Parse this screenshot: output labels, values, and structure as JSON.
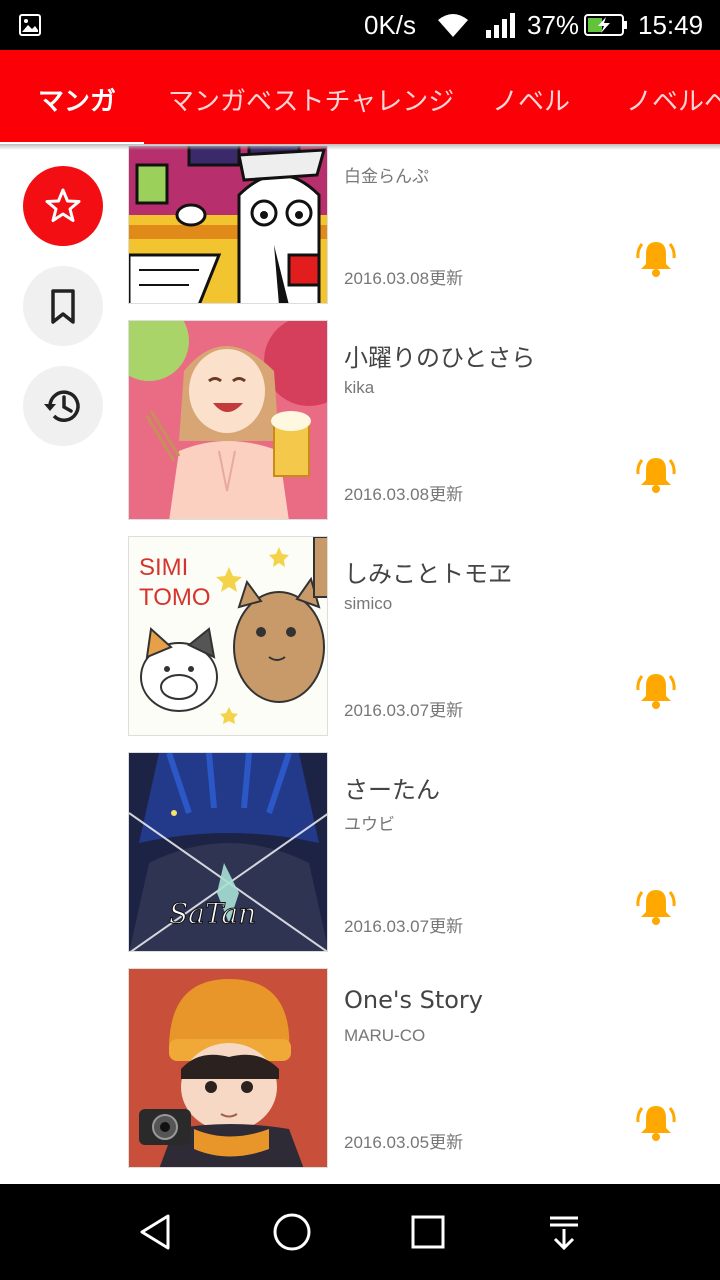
{
  "status_bar": {
    "speed": "0K/s",
    "battery_percent": "37%",
    "time": "15:49",
    "icons": [
      "gallery-icon",
      "wifi-icon",
      "signal-icon",
      "battery-charging-icon"
    ]
  },
  "tabs": [
    {
      "label": "マンガ",
      "selected": true
    },
    {
      "label": "マンガベストチャレンジ",
      "selected": false
    },
    {
      "label": "ノベル",
      "selected": false
    },
    {
      "label": "ノベルベ",
      "selected": false
    }
  ],
  "side_buttons": [
    {
      "name": "favorites",
      "icon": "star-icon",
      "active": true
    },
    {
      "name": "bookmarks",
      "icon": "bookmark-icon",
      "active": false
    },
    {
      "name": "history",
      "icon": "history-icon",
      "active": false
    }
  ],
  "items": [
    {
      "title": "",
      "author": "白金らんぷ",
      "updated": "2016.03.08更新"
    },
    {
      "title": "小躍りのひとさら",
      "author": "kika",
      "updated": "2016.03.08更新"
    },
    {
      "title": "しみことトモヱ",
      "author": "simico",
      "updated": "2016.03.07更新"
    },
    {
      "title": "さーたん",
      "author": "ユウビ",
      "updated": "2016.03.07更新"
    },
    {
      "title": "One's Story",
      "author": "MARU-CO",
      "updated": "2016.03.05更新"
    }
  ],
  "thumb_texts": {
    "simitomo_line1": "SIMI",
    "simitomo_line2": "TOMO",
    "saatan_logo": "SaTan"
  },
  "colors": {
    "accent_red": "#fb0007",
    "bell_orange": "#ffa800"
  },
  "nav_icons": [
    "back-icon",
    "home-icon",
    "recents-icon",
    "notification-pull-icon"
  ]
}
